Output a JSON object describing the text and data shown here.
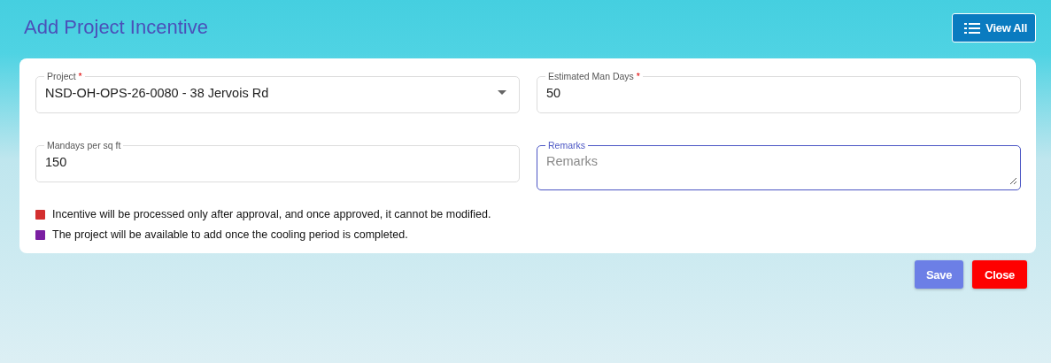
{
  "header": {
    "title": "Add Project Incentive",
    "view_all_button": "View All"
  },
  "fields": [
    {
      "kind": "select",
      "label": "Project",
      "required_mark": "*",
      "value": "NSD-OH-OPS-26-0080 - 38 Jervois Rd",
      "focused": false
    },
    {
      "kind": "text",
      "label": "Estimated Man Days",
      "required_mark": "*",
      "value": "50",
      "focused": false
    },
    {
      "kind": "text",
      "label": "Mandays per sq ft",
      "value": "150",
      "focused": false
    },
    {
      "kind": "textarea",
      "label": "Remarks",
      "placeholder": "Remarks",
      "focused": true
    }
  ],
  "notes": [
    {
      "text": "Incentive will be processed only after approval, and once approved, it cannot be modified.",
      "color": "#d32f2f"
    },
    {
      "text": "The project will be available to add once the cooling period is completed.",
      "color": "#7b1fa2"
    }
  ],
  "buttons": [
    {
      "label": "Save",
      "kind": "primary"
    },
    {
      "label": "Close",
      "kind": "danger"
    }
  ]
}
